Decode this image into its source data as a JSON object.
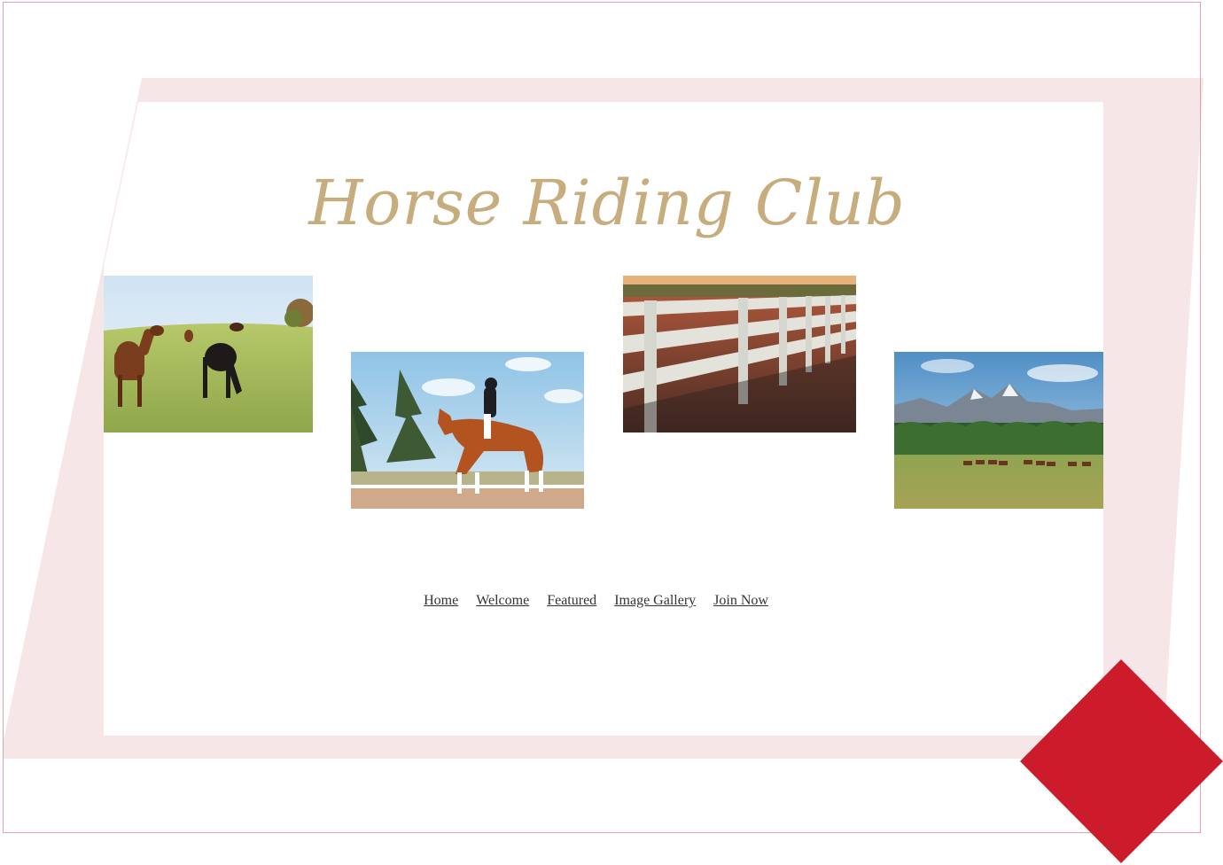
{
  "site": {
    "title": "Horse Riding Club"
  },
  "gallery": {
    "photos": [
      {
        "name": "grazing-horses-meadow-photo"
      },
      {
        "name": "dressage-rider-photo"
      },
      {
        "name": "arena-fence-photo"
      },
      {
        "name": "mountain-pasture-herd-photo"
      }
    ]
  },
  "nav": {
    "items": [
      {
        "label": "Home"
      },
      {
        "label": "Welcome"
      },
      {
        "label": "Featured"
      },
      {
        "label": "Image Gallery"
      },
      {
        "label": "Join Now"
      }
    ]
  },
  "colors": {
    "title": "#c7ac7d",
    "frame_border": "#e0a2aa",
    "pink_band": "#f7e6e8",
    "accent_diamond": "#cc1c2c",
    "nav_text": "#333333"
  }
}
